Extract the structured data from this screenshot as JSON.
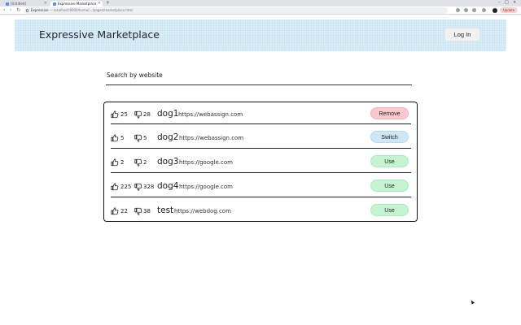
{
  "browser": {
    "tabs": [
      {
        "label": "[Untitled]"
      },
      {
        "label": "Expressive Marketplace"
      }
    ],
    "new_tab": "+",
    "url_host": "Expressive",
    "url_path": " — localhost:8000/home/.../pages/marketplace.html",
    "update_label": "Update"
  },
  "header": {
    "title": "Expressive Marketplace",
    "login_label": "Log In"
  },
  "search": {
    "label": "Search by website"
  },
  "colors": {
    "remove": "#f9c9cf",
    "switch": "#cfe6f7",
    "use": "#c6f3d2"
  },
  "rows": [
    {
      "likes": "25",
      "dislikes": "28",
      "name": "dog1",
      "website": "https://webassign.com",
      "action": "Remove",
      "action_type": "remove"
    },
    {
      "likes": "5",
      "dislikes": "5",
      "name": "dog2",
      "website": "https://webassign.com",
      "action": "Switch",
      "action_type": "switch"
    },
    {
      "likes": "2",
      "dislikes": "2",
      "name": "dog3",
      "website": "https://google.com",
      "action": "Use",
      "action_type": "use"
    },
    {
      "likes": "225",
      "dislikes": "328",
      "name": "dog4",
      "website": "https://google.com",
      "action": "Use",
      "action_type": "use"
    },
    {
      "likes": "22",
      "dislikes": "38",
      "name": "test",
      "website": "https://webdog.com",
      "action": "Use",
      "action_type": "use"
    }
  ]
}
